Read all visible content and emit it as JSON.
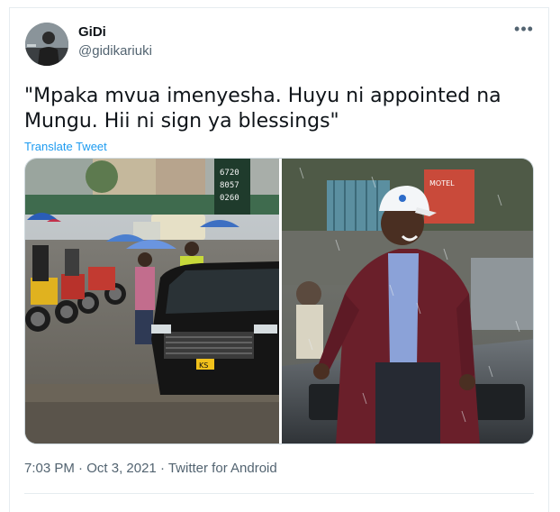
{
  "tweet": {
    "display_name": "GiDi",
    "handle": "@gidikariuki",
    "text": "\"Mpaka mvua imenyesha. Huyu ni appointed na Mungu. Hii ni sign ya blessings\"",
    "translate_label": "Translate Tweet",
    "more_icon": "more-horizontal-icon",
    "time": "7:03 PM",
    "separator": " · ",
    "date": "Oct 3, 2021",
    "source": "Twitter for Android"
  },
  "media": {
    "left_photo": {
      "sign_line_1": "6720",
      "sign_line_2": "8057",
      "sign_line_3": "0260",
      "plate": "KS"
    },
    "right_photo": {
      "banner": "MOTEL"
    }
  },
  "colors": {
    "link": "#1d9bf0",
    "secondary_text": "#536471",
    "primary_text": "#0f1419",
    "border": "#cfd9de"
  }
}
